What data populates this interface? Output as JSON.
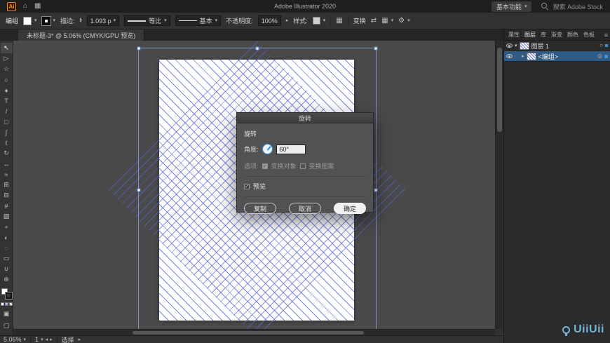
{
  "titlebar": {
    "ai_logo": "Ai",
    "app_title": "Adobe Illustrator 2020",
    "workspace": "基本功能",
    "search_placeholder": "搜索 Adobe Stock"
  },
  "controlbar": {
    "context_label": "编组",
    "stroke_label": "描边:",
    "stroke_value": "1.093 p",
    "profile_value": "等比",
    "brush_value": "基本",
    "opacity_label": "不透明度:",
    "opacity_value": "100%",
    "style_label": "样式:",
    "transform_label": "变换"
  },
  "document_tab": {
    "title": "未标题-3* @ 5.06% (CMYK/GPU 预览)"
  },
  "tools": [
    {
      "name": "selection-tool",
      "glyph": "↖"
    },
    {
      "name": "direct-selection-tool",
      "glyph": "▷"
    },
    {
      "name": "magic-wand-tool",
      "glyph": "☆"
    },
    {
      "name": "lasso-tool",
      "glyph": "○"
    },
    {
      "name": "pen-tool",
      "glyph": "♦"
    },
    {
      "name": "type-tool",
      "glyph": "T"
    },
    {
      "name": "line-segment-tool",
      "glyph": "/"
    },
    {
      "name": "rectangle-tool",
      "glyph": "□"
    },
    {
      "name": "paintbrush-tool",
      "glyph": "∫"
    },
    {
      "name": "pencil-tool",
      "glyph": "ℓ"
    },
    {
      "name": "rotate-tool",
      "glyph": "↻"
    },
    {
      "name": "scale-tool",
      "glyph": "↔"
    },
    {
      "name": "width-tool",
      "glyph": "≈"
    },
    {
      "name": "free-transform-tool",
      "glyph": "⊞"
    },
    {
      "name": "shape-builder-tool",
      "glyph": "⊟"
    },
    {
      "name": "mesh-tool",
      "glyph": "#"
    },
    {
      "name": "gradient-tool",
      "glyph": "▨"
    },
    {
      "name": "eyedropper-tool",
      "glyph": "+"
    },
    {
      "name": "blend-tool",
      "glyph": "◐"
    },
    {
      "name": "symbol-sprayer-tool",
      "glyph": "◌"
    },
    {
      "name": "artboard-tool",
      "glyph": "▭"
    },
    {
      "name": "hand-tool",
      "glyph": "∪"
    },
    {
      "name": "zoom-tool",
      "glyph": "⊕"
    }
  ],
  "dialog": {
    "title": "旋转",
    "section_label": "旋转",
    "angle_label": "角度:",
    "angle_value": "60°",
    "options_label": "选项:",
    "transform_objects_label": "变换对象",
    "transform_patterns_label": "变换图案",
    "preview_label": "预览",
    "copy_button": "复制",
    "cancel_button": "取消",
    "ok_button": "确定"
  },
  "layers_panel": {
    "tabs": [
      {
        "label": "属性"
      },
      {
        "label": "图层"
      },
      {
        "label": "库"
      },
      {
        "label": "渐变"
      },
      {
        "label": "颜色"
      },
      {
        "label": "色板"
      }
    ],
    "rows": [
      {
        "name": "图层 1"
      },
      {
        "name": "<编组>"
      }
    ]
  },
  "statusbar": {
    "zoom": "5.06%",
    "artboard_number": "1",
    "status_text": "选择"
  },
  "watermark": {
    "text": "UiiUii"
  },
  "colors": {
    "hatch_blue": "#5866d8",
    "selection_border": "#96afeb",
    "layer_highlight": "#2f5a84",
    "accent_orange": "#ff8a00"
  }
}
